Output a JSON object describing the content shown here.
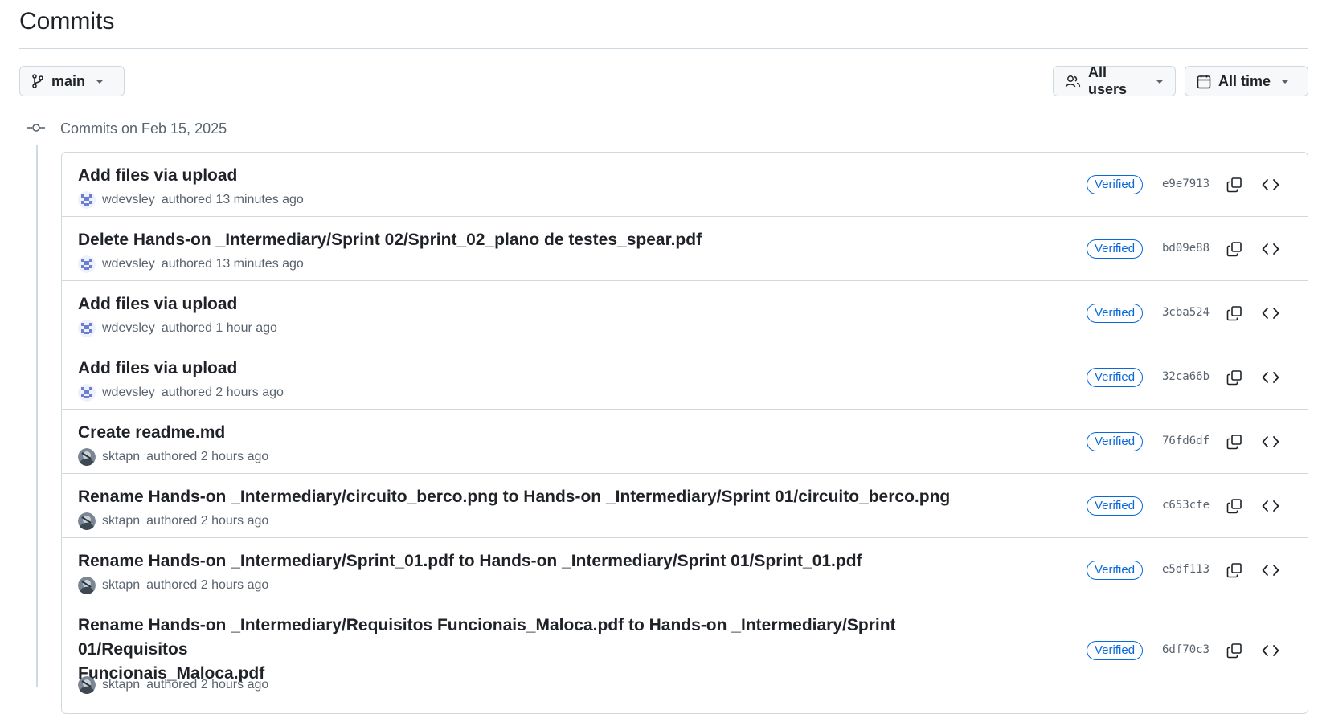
{
  "page": {
    "title": "Commits"
  },
  "filters": {
    "branch": "main",
    "users": "All users",
    "time": "All time"
  },
  "group": {
    "label": "Commits on Feb 15, 2025"
  },
  "commits": [
    {
      "title": "Add files via upload",
      "title_line2": "",
      "author": "wdevsley",
      "authored": "authored 13 minutes ago",
      "verified": "Verified",
      "sha": "e9e7913",
      "avatar": "pattern"
    },
    {
      "title": "Delete Hands-on _Intermediary/Sprint 02/Sprint_02_plano de testes_spear.pdf",
      "title_line2": "",
      "author": "wdevsley",
      "authored": "authored 13 minutes ago",
      "verified": "Verified",
      "sha": "bd09e88",
      "avatar": "pattern"
    },
    {
      "title": "Add files via upload",
      "title_line2": "",
      "author": "wdevsley",
      "authored": "authored 1 hour ago",
      "verified": "Verified",
      "sha": "3cba524",
      "avatar": "pattern"
    },
    {
      "title": "Add files via upload",
      "title_line2": "",
      "author": "wdevsley",
      "authored": "authored 2 hours ago",
      "verified": "Verified",
      "sha": "32ca66b",
      "avatar": "pattern"
    },
    {
      "title": "Create readme.md",
      "title_line2": "",
      "author": "sktapn",
      "authored": "authored 2 hours ago",
      "verified": "Verified",
      "sha": "76fd6df",
      "avatar": "photo"
    },
    {
      "title": "Rename Hands-on _Intermediary/circuito_berco.png to Hands-on _Intermediary/Sprint 01/circuito_berco.png",
      "title_line2": "",
      "author": "sktapn",
      "authored": "authored 2 hours ago",
      "verified": "Verified",
      "sha": "c653cfe",
      "avatar": "photo"
    },
    {
      "title": "Rename Hands-on _Intermediary/Sprint_01.pdf to Hands-on _Intermediary/Sprint 01/Sprint_01.pdf",
      "title_line2": "",
      "author": "sktapn",
      "authored": "authored 2 hours ago",
      "verified": "Verified",
      "sha": "e5df113",
      "avatar": "photo"
    },
    {
      "title": "Rename Hands-on _Intermediary/Requisitos Funcionais_Maloca.pdf to Hands-on _Intermediary/Sprint 01/Requisitos",
      "title_line2": "Funcionais_Maloca.pdf",
      "author": "sktapn",
      "authored": "authored 2 hours ago",
      "verified": "Verified",
      "sha": "6df70c3",
      "avatar": "photo"
    }
  ],
  "icons": {
    "branch": "git-branch-icon",
    "users": "people-icon",
    "time": "calendar-icon",
    "group": "git-commit-icon",
    "copy": "copy-icon",
    "browse": "code-icon"
  },
  "colors": {
    "verified": "#0969da",
    "border": "#d1d9e0",
    "muted": "#59636e",
    "text": "#1f2328"
  }
}
